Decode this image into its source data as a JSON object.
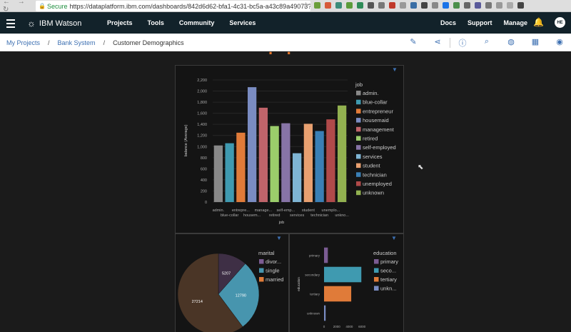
{
  "browser": {
    "secure_label": "Secure",
    "url": "https://dataplatform.ibm.com/dashboards/842d6d62-bfa1-4c31-bc5a-a43c89a49073?..."
  },
  "topnav": {
    "brand": "IBM Watson",
    "links": [
      "Projects",
      "Tools",
      "Community",
      "Services"
    ],
    "right_links": [
      "Docs",
      "Support",
      "Manage"
    ],
    "avatar_initials": "HE"
  },
  "breadcrumb": {
    "items": [
      "My Projects",
      "Bank System",
      "Customer Demographics"
    ]
  },
  "colors": {
    "admin": "#7b5c93",
    "blue-collar": "#3f9ab0",
    "entrepreneur": "#e07b39",
    "housemaid": "#7a8cc2",
    "management": "#c0646a",
    "retired": "#9bcd6b",
    "self-employed": "#8774a6",
    "services": "#7fb5d4",
    "student": "#e8a070",
    "technician": "#3a7fb5",
    "unemployed": "#b04a4a",
    "unknown": "#92b150"
  },
  "chart_data": [
    {
      "type": "bar",
      "title": "",
      "xlabel": "job",
      "ylabel": "balance (Average)",
      "ylim": [
        0,
        2200
      ],
      "yticks": [
        "0",
        "200",
        "400",
        "600",
        "800",
        "1,000",
        "1,200",
        "1,400",
        "1,600",
        "1,800",
        "2,000",
        "2,200"
      ],
      "categories": [
        "admin.",
        "blue-collar",
        "entrepreneur",
        "housemaid",
        "management",
        "retired",
        "self-employed",
        "services",
        "student",
        "technician",
        "unemployed",
        "unknown"
      ],
      "tick_labels_row1": [
        "admin.",
        "entrepre...",
        "manage...",
        "self-emp...",
        "student",
        "unemplo..."
      ],
      "tick_labels_row2": [
        "blue-collar",
        "housem...",
        "retired",
        "services",
        "technician",
        "unkno..."
      ],
      "values": [
        1020,
        1060,
        1250,
        2070,
        1700,
        1370,
        1420,
        880,
        1410,
        1280,
        1490,
        1740
      ],
      "legend_title": "job",
      "legend": [
        "admin.",
        "blue-collar",
        "entrepreneur",
        "housemaid",
        "management",
        "retired",
        "self-employed",
        "services",
        "student",
        "technician",
        "unemployed",
        "unknown"
      ],
      "legend_placement": "right"
    },
    {
      "type": "pie",
      "legend_title": "marital",
      "categories": [
        "divorced",
        "single",
        "married"
      ],
      "legend": [
        "divor...",
        "single",
        "married"
      ],
      "values": [
        5207,
        12790,
        27214
      ],
      "labels": [
        "5207",
        "12790",
        "27214"
      ],
      "colors": [
        "#3e2f45",
        "#4795ae",
        "#4a3526"
      ],
      "legend_colors": [
        "#7b5c93",
        "#4795ae",
        "#e07b39"
      ],
      "legend_placement": "right"
    },
    {
      "type": "bar",
      "orientation": "horizontal",
      "ylabel": "education",
      "categories": [
        "primary",
        "secondary",
        "tertiary",
        "unknown"
      ],
      "values": [
        600,
        5900,
        4300,
        250
      ],
      "xticks": [
        "0",
        "2000",
        "4000",
        "6000"
      ],
      "xlim": [
        0,
        7000
      ],
      "colors": [
        "#7b5c93",
        "#3f9ab0",
        "#e07b39",
        "#7a8cc2"
      ],
      "legend_title": "education",
      "legend": [
        "primary",
        "seco...",
        "tertiary",
        "unkn..."
      ],
      "legend_placement": "right"
    }
  ]
}
